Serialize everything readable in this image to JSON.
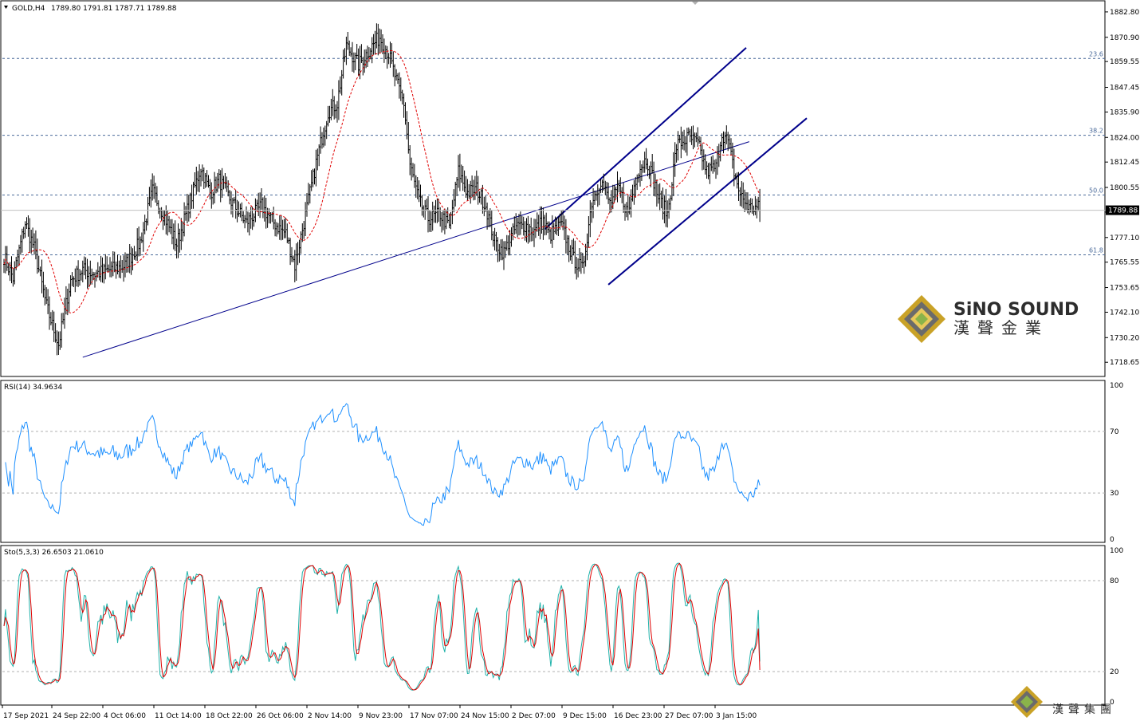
{
  "chart_data": [
    {
      "type": "candlestick",
      "symbol": "GOLD",
      "timeframe": "H4",
      "header": {
        "symbol_tf": "GOLD,H4",
        "ohlc": "1789.80 1791.81 1787.71 1789.88"
      },
      "current_price_label": "1789.88",
      "current_price": 1789.88,
      "ylim": [
        1712,
        1888
      ],
      "y_ticks": [
        "1882.80",
        "1870.90",
        "1859.55",
        "1847.45",
        "1835.90",
        "1824.00",
        "1812.45",
        "1800.55",
        "1789.00",
        "1777.10",
        "1765.55",
        "1753.65",
        "1742.10",
        "1730.20",
        "1718.65"
      ],
      "fib_levels": [
        {
          "label": "23.6",
          "price": 1861.0
        },
        {
          "label": "38.2",
          "price": 1825.0
        },
        {
          "label": "50.0",
          "price": 1797.0
        },
        {
          "label": "61.8",
          "price": 1769.0
        }
      ],
      "x_labels": [
        "17 Sep 2021",
        "24 Sep 22:00",
        "4 Oct 06:00",
        "11 Oct 14:00",
        "18 Oct 22:00",
        "26 Oct 06:00",
        "2 Nov 14:00",
        "9 Nov 23:00",
        "17 Nov 07:00",
        "24 Nov 15:00",
        "2 Dec 07:00",
        "9 Dec 15:00",
        "16 Dec 23:00",
        "27 Dec 07:00",
        "3 Jan 15:00"
      ],
      "close_anchors": [
        [
          0,
          1768
        ],
        [
          6,
          1758
        ],
        [
          14,
          1784
        ],
        [
          20,
          1772
        ],
        [
          28,
          1745
        ],
        [
          36,
          1727
        ],
        [
          44,
          1757
        ],
        [
          52,
          1762
        ],
        [
          60,
          1760
        ],
        [
          70,
          1762
        ],
        [
          80,
          1764
        ],
        [
          90,
          1775
        ],
        [
          98,
          1799
        ],
        [
          104,
          1790
        ],
        [
          114,
          1774
        ],
        [
          122,
          1792
        ],
        [
          130,
          1810
        ],
        [
          136,
          1798
        ],
        [
          142,
          1804
        ],
        [
          150,
          1794
        ],
        [
          160,
          1784
        ],
        [
          170,
          1792
        ],
        [
          178,
          1784
        ],
        [
          186,
          1779
        ],
        [
          192,
          1764
        ],
        [
          200,
          1791
        ],
        [
          206,
          1812
        ],
        [
          214,
          1836
        ],
        [
          220,
          1840
        ],
        [
          226,
          1867
        ],
        [
          234,
          1858
        ],
        [
          242,
          1866
        ],
        [
          248,
          1871
        ],
        [
          254,
          1863
        ],
        [
          260,
          1848
        ],
        [
          264,
          1840
        ],
        [
          268,
          1811
        ],
        [
          274,
          1794
        ],
        [
          280,
          1786
        ],
        [
          288,
          1788
        ],
        [
          294,
          1782
        ],
        [
          300,
          1808
        ],
        [
          306,
          1798
        ],
        [
          312,
          1800
        ],
        [
          318,
          1792
        ],
        [
          324,
          1775
        ],
        [
          330,
          1770
        ],
        [
          338,
          1782
        ],
        [
          344,
          1783
        ],
        [
          350,
          1780
        ],
        [
          356,
          1785
        ],
        [
          360,
          1778
        ],
        [
          368,
          1783
        ],
        [
          376,
          1767
        ],
        [
          382,
          1762
        ],
        [
          388,
          1794
        ],
        [
          394,
          1804
        ],
        [
          400,
          1793
        ],
        [
          406,
          1800
        ],
        [
          412,
          1788
        ],
        [
          418,
          1808
        ],
        [
          424,
          1814
        ],
        [
          428,
          1806
        ],
        [
          432,
          1796
        ],
        [
          438,
          1788
        ],
        [
          444,
          1820
        ],
        [
          452,
          1824
        ],
        [
          458,
          1821
        ],
        [
          464,
          1808
        ],
        [
          470,
          1810
        ],
        [
          474,
          1826
        ],
        [
          478,
          1822
        ],
        [
          482,
          1808
        ],
        [
          486,
          1797
        ],
        [
          492,
          1791
        ]
      ],
      "indicator_labels": {
        "rsi": "RSI(14) 34.9634",
        "sto": "Sto(5,3,3) 26.6503 21.0610"
      },
      "rsi_ticks": [
        "100",
        "70",
        "30",
        "0"
      ],
      "sto_ticks": [
        "100",
        "80",
        "20",
        "0"
      ],
      "rsi_last": 34.9634,
      "sto_last": [
        26.6503,
        21.061
      ]
    }
  ],
  "watermark": {
    "brand_en": "SiNO SOUND",
    "brand_cn": "漢聲金業",
    "footer_cn": "漢聲集團"
  },
  "colors": {
    "candle": "#000000",
    "ma": "#e00000",
    "trendline": "#00008b",
    "rsi": "#1e90ff",
    "sto_main": "#20b2aa",
    "sto_signal": "#e00000",
    "fib": "#4a6a9a"
  }
}
